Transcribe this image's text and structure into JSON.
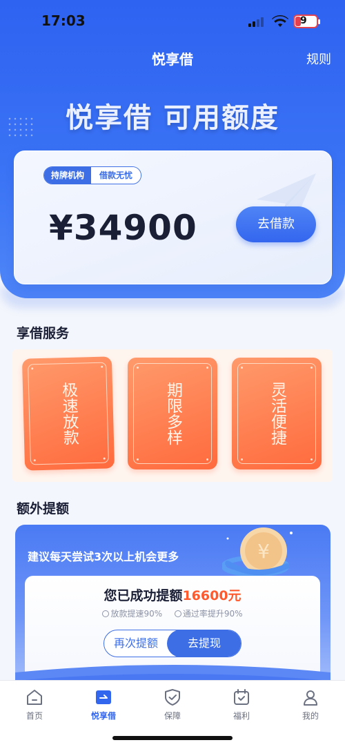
{
  "status_bar": {
    "time": "17:03",
    "battery": "9"
  },
  "nav": {
    "title": "悦享借",
    "rules_label": "规则"
  },
  "hero": {
    "headline": "悦享借 可用额度"
  },
  "credit_card": {
    "tag_licensed": "持牌机构",
    "tag_worry_free": "借款无忧",
    "amount": "¥34900",
    "borrow_button": "去借款"
  },
  "services": {
    "title": "享借服务",
    "items": [
      {
        "label": "极速放款"
      },
      {
        "label": "期限多样"
      },
      {
        "label": "灵活便捷"
      }
    ]
  },
  "extra_quota": {
    "title": "额外提额",
    "hint": "建议每天尝试3次以上机会更多",
    "success_prefix": "您已成功提额",
    "success_amount": "16600元",
    "feature_1": "放款提速90%",
    "feature_2": "通过率提升90%",
    "retry_button": "再次提额",
    "withdraw_button": "去提现"
  },
  "tabbar": {
    "items": [
      {
        "label": "首页",
        "icon": "home-icon"
      },
      {
        "label": "悦享借",
        "icon": "loan-icon"
      },
      {
        "label": "保障",
        "icon": "shield-icon"
      },
      {
        "label": "福利",
        "icon": "calendar-check-icon"
      },
      {
        "label": "我的",
        "icon": "user-icon"
      }
    ],
    "active_index": 1
  },
  "colors": {
    "brand": "#3366ee",
    "accent_orange": "#ff6a3d",
    "highlight_red": "#ff5a2d"
  }
}
